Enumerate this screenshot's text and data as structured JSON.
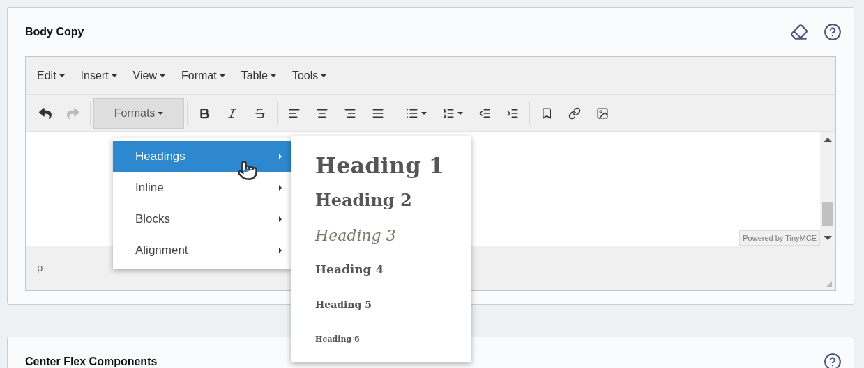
{
  "panels": [
    {
      "title": "Body Copy",
      "show_eraser": true,
      "editor": {
        "menubar": [
          "Edit",
          "Insert",
          "View",
          "Format",
          "Table",
          "Tools"
        ],
        "toolbar": [
          {
            "kind": "undo",
            "disabled": false
          },
          {
            "kind": "redo",
            "disabled": true
          },
          {
            "kind": "formats",
            "label": "Formats",
            "open": true
          },
          {
            "kind": "bold",
            "disabled": false
          },
          {
            "kind": "italic",
            "disabled": false
          },
          {
            "kind": "strikethrough",
            "disabled": false
          },
          {
            "kind": "align-left",
            "disabled": false
          },
          {
            "kind": "align-center",
            "disabled": false
          },
          {
            "kind": "align-right",
            "disabled": false
          },
          {
            "kind": "align-justify",
            "disabled": false
          },
          {
            "kind": "bullet-list",
            "disabled": false
          },
          {
            "kind": "numbered-list",
            "disabled": false
          },
          {
            "kind": "outdent",
            "disabled": false
          },
          {
            "kind": "indent",
            "disabled": false
          },
          {
            "kind": "bookmark",
            "disabled": false
          },
          {
            "kind": "link",
            "disabled": false
          },
          {
            "kind": "image",
            "disabled": false
          }
        ],
        "branding": "Powered by TinyMCE",
        "status_path": "p"
      }
    },
    {
      "title": "Center Flex Components",
      "show_eraser": false
    }
  ],
  "formats_menu": {
    "items": [
      {
        "label": "Headings",
        "selected": true
      },
      {
        "label": "Inline",
        "selected": false
      },
      {
        "label": "Blocks",
        "selected": false
      },
      {
        "label": "Alignment",
        "selected": false
      }
    ],
    "submenu": [
      {
        "label": "Heading 1",
        "kind": "h1"
      },
      {
        "label": "Heading 2",
        "kind": "h2"
      },
      {
        "label": "Heading 3",
        "kind": "h3"
      },
      {
        "label": "Heading 4",
        "kind": "h4"
      },
      {
        "label": "Heading 5",
        "kind": "h5"
      },
      {
        "label": "Heading 6",
        "kind": "h6"
      }
    ]
  }
}
